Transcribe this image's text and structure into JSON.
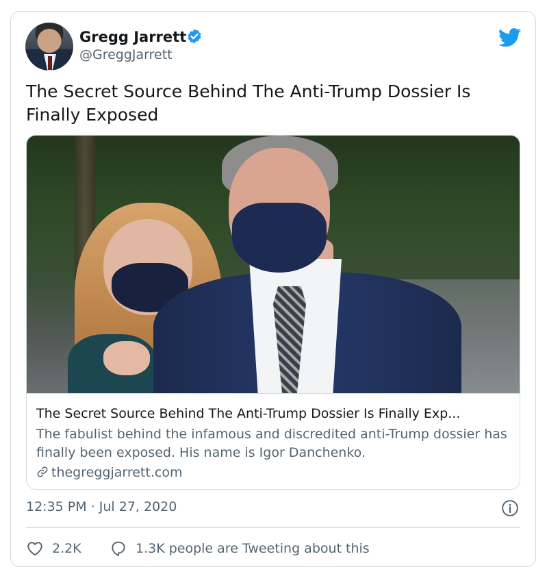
{
  "author": {
    "name": "Gregg Jarrett",
    "handle": "@GreggJarrett",
    "verified": true
  },
  "tweet": {
    "text": "The Secret Source Behind The Anti-Trump Dossier Is Finally Exposed",
    "timestamp": "12:35 PM · Jul 27, 2020"
  },
  "card": {
    "title": "The Secret Source Behind The Anti-Trump Dossier Is Finally Exp...",
    "description": "The fabulist behind the infamous and discredited anti-Trump dossier has finally been exposed.  His name is Igor Danchenko.",
    "domain": "thegreggjarrett.com"
  },
  "actions": {
    "likes": "2.2K",
    "conversation": "1.3K people are Tweeting about this"
  },
  "icons": {
    "brand": "twitter-bird-icon",
    "verified": "verified-badge-icon",
    "link": "link-icon",
    "info": "info-icon",
    "like": "heart-icon",
    "reply": "speech-bubble-icon"
  },
  "colors": {
    "twitter_blue": "#1d9bf0",
    "text_primary": "#14171a",
    "text_secondary": "#536471",
    "border": "#cfd9de"
  }
}
